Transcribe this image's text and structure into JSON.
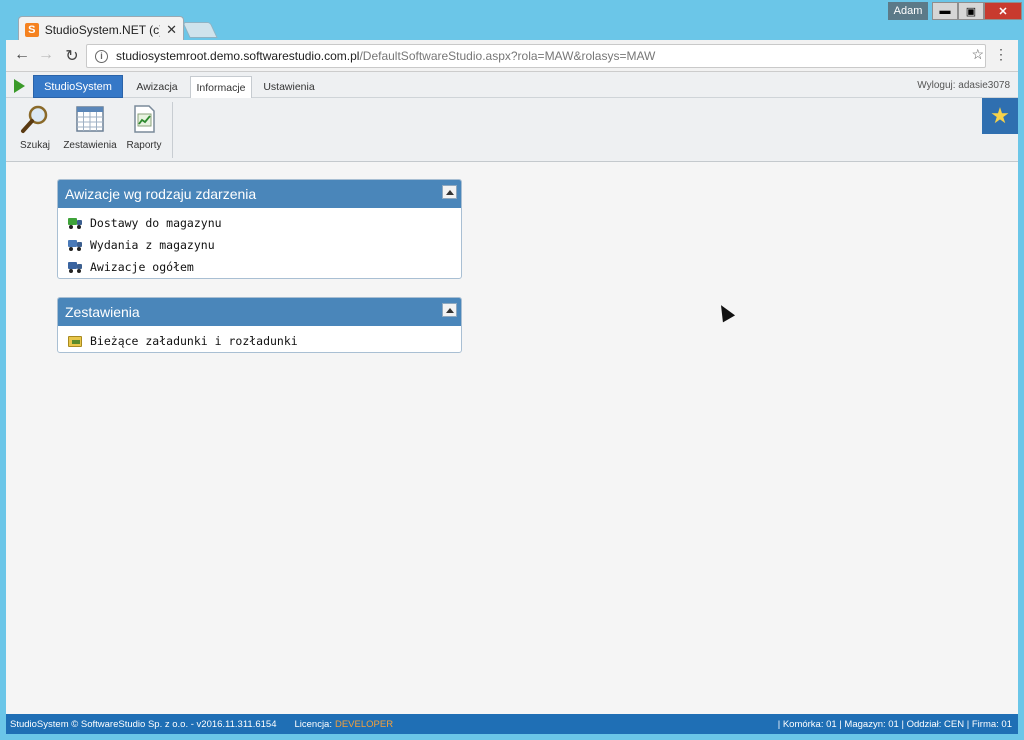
{
  "browser": {
    "tab_title": "StudioSystem.NET (c) So",
    "tab_favicon": "S",
    "user": "Adam",
    "win_min": "▬",
    "win_max": "▣",
    "win_close": "✕",
    "url_host": "studiosystemroot.demo.softwarestudio.com.pl",
    "url_path": "/DefaultSoftwareStudio.aspx?rola=MAW&rolasys=MAW"
  },
  "nav": {
    "brand": "StudioSystem",
    "tabs": [
      "Awizacja",
      "Informacje",
      "Ustawienia"
    ],
    "active_tab": "Informacje",
    "logout": "Wyloguj: adasie3078"
  },
  "ribbon": {
    "items": [
      "Szukaj",
      "Zestawienia",
      "Raporty"
    ]
  },
  "panels": [
    {
      "title": "Awizacje wg rodzaju zdarzenia",
      "items": [
        "Dostawy do magazynu",
        "Wydania z magazynu",
        "Awizacje ogółem"
      ]
    },
    {
      "title": "Zestawienia",
      "items": [
        "Bieżące załadunki i rozładunki"
      ]
    }
  ],
  "footer": {
    "copyright": "StudioSystem © SoftwareStudio Sp. z o.o. - v2016.11.311.6154",
    "license_label": "Licencja:",
    "license_value": "DEVELOPER",
    "status": "| Komórka: 01 | Magazyn: 01 | Oddział: CEN | Firma: 01"
  },
  "colors": {
    "accent": "#3578c7",
    "panel_header": "#4a86ba",
    "footer": "#1f6fb5",
    "license": "#f6a03a"
  }
}
